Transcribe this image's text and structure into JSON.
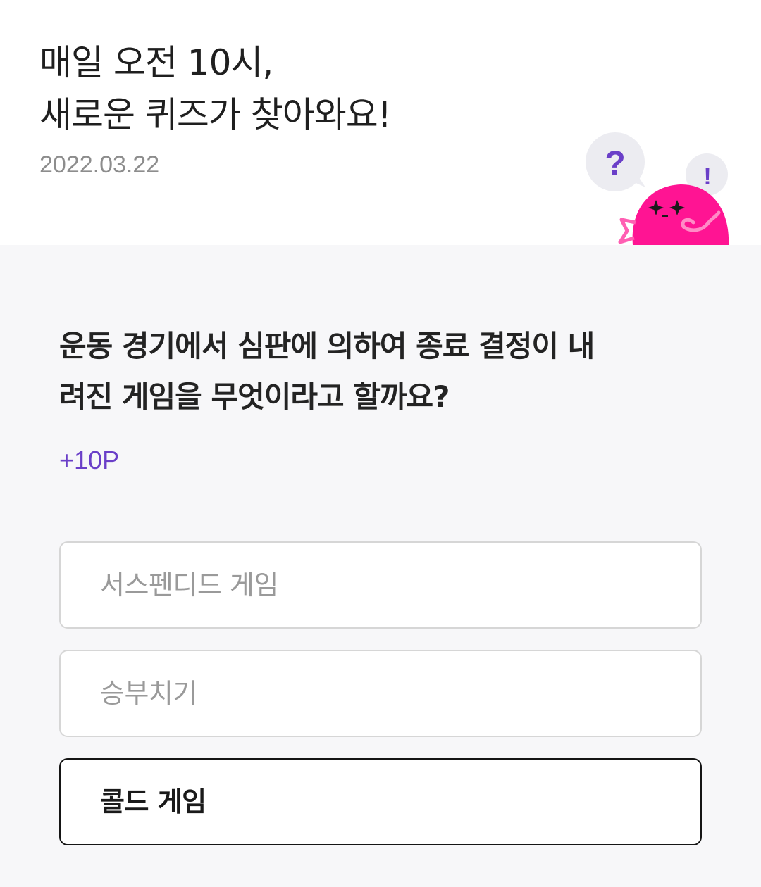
{
  "header": {
    "headline_line1": "매일 오전 10시,",
    "headline_line2": "새로운 퀴즈가 찾아와요!",
    "date": "2022.03.22"
  },
  "mascot": {
    "icon": "quiz-mascot-icon",
    "bubble_left": "?",
    "bubble_right": "!",
    "body_color": "#ff1493",
    "accent_color": "#6a3fc8"
  },
  "quiz": {
    "question_line1": "운동 경기에서 심판에 의하여 종료 결정이 내",
    "question_line2": "려진 게임을 무엇이라고 할까요?",
    "points": "+10P",
    "options": [
      {
        "label": "서스펜디드 게임",
        "selected": false
      },
      {
        "label": "승부치기",
        "selected": false
      },
      {
        "label": "콜드 게임",
        "selected": true
      }
    ]
  }
}
